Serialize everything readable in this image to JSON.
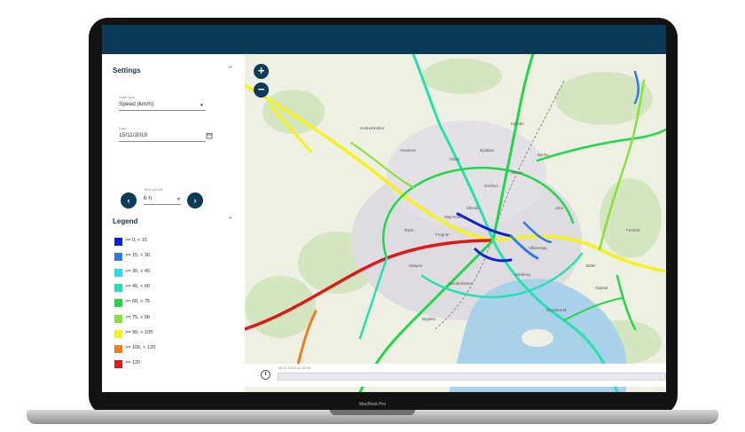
{
  "settings": {
    "title": "Settings",
    "state_label": "State type",
    "state_value": "Speed (km/h)",
    "date_label": "Date",
    "date_value": "15/11/2019",
    "period_label": "Time period",
    "period_value": "6 h"
  },
  "legend": {
    "title": "Legend",
    "items": [
      {
        "label": ">= 0, < 15",
        "color": "#0a1fd6"
      },
      {
        "label": ">= 15, < 30",
        "color": "#2f7ae8"
      },
      {
        "label": ">= 30, < 45",
        "color": "#27dcee"
      },
      {
        "label": ">= 45, < 60",
        "color": "#26e0b0"
      },
      {
        "label": ">= 60, < 75",
        "color": "#22d64a"
      },
      {
        "label": ">= 75, < 90",
        "color": "#86e236"
      },
      {
        "label": ">= 90, < 105",
        "color": "#f6f21e"
      },
      {
        "label": ">= 105, < 120",
        "color": "#f07f1a"
      },
      {
        "label": ">= 120",
        "color": "#e01818"
      }
    ]
  },
  "timeline": {
    "label": "06.11.2019 11:15:00"
  },
  "icons": {
    "zoom_in": "plus-icon",
    "zoom_out": "minus-icon",
    "prev": "chevron-left-icon",
    "next": "chevron-right-icon",
    "date": "calendar-icon",
    "clock": "clock-icon",
    "collapse": "chevron-up-icon"
  },
  "map_labels": [
    "Ryen",
    "Bjerke",
    "Alna",
    "Lambertseter",
    "Furuset",
    "Bygdøy",
    "Ekeberg",
    "Grefsen",
    "Sinsen",
    "Frogner",
    "Majorstuen",
    "Ullevål",
    "Nydalen",
    "Skøyen",
    "Tåsen",
    "Kjelsås",
    "Holmenkollen",
    "Vinderen",
    "Bøler",
    "Nordstrand",
    "Oppsal",
    "Vålerenga"
  ],
  "device": {
    "brand": "MacBook Pro"
  }
}
